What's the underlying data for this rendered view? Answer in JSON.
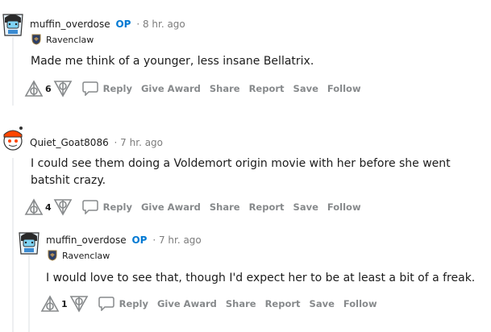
{
  "comments": [
    {
      "user": "muffin_overdose",
      "op": "OP",
      "time": "· 8 hr. ago",
      "flair": "Ravenclaw",
      "body": "Made me think of a younger, less insane Bellatrix.",
      "votes": "6",
      "actions": {
        "reply": "Reply",
        "award": "Give Award",
        "share": "Share",
        "report": "Report",
        "save": "Save",
        "follow": "Follow"
      }
    },
    {
      "user": "Quiet_Goat8086",
      "time": "· 7 hr. ago",
      "body": "I could see them doing a Voldemort origin movie with her before she went batshit crazy.",
      "votes": "4",
      "actions": {
        "reply": "Reply",
        "award": "Give Award",
        "share": "Share",
        "report": "Report",
        "save": "Save",
        "follow": "Follow"
      }
    },
    {
      "user": "muffin_overdose",
      "op": "OP",
      "time": "· 7 hr. ago",
      "flair": "Ravenclaw",
      "body": "I would love to see that, though I'd expect her to be at least a bit of a freak.",
      "votes": "1",
      "actions": {
        "reply": "Reply",
        "award": "Give Award",
        "share": "Share",
        "report": "Report",
        "save": "Save",
        "follow": "Follow"
      }
    }
  ],
  "icons": {
    "upvote": "deathly-hallows-upvote-icon",
    "downvote": "deathly-hallows-downvote-icon",
    "reply": "speech-bubble-icon",
    "flair": "ravenclaw-crest-icon"
  },
  "colors": {
    "op": "#0079d3",
    "muted": "#878a8c",
    "thread": "#edeff1"
  }
}
